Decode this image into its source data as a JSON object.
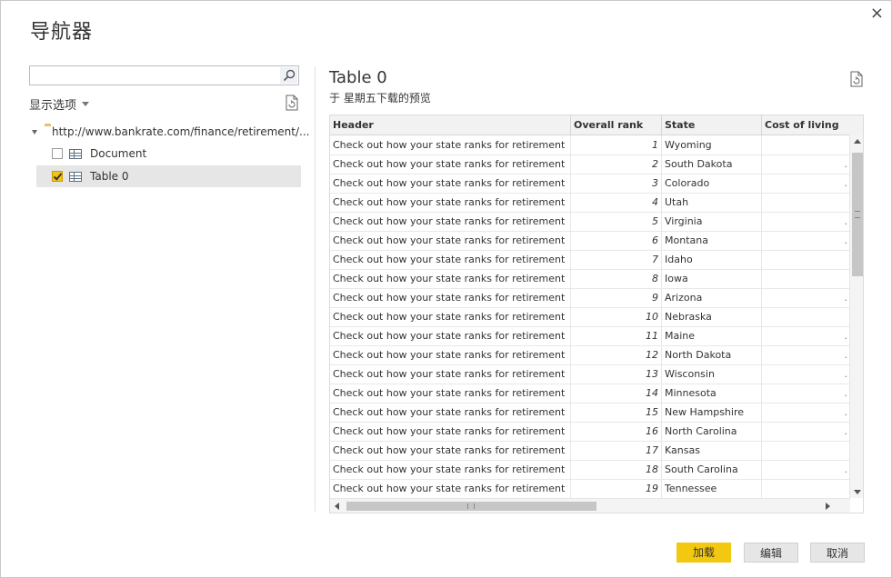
{
  "window": {
    "title": "导航器",
    "close_label": "×"
  },
  "left": {
    "search_value": "",
    "display_options_label": "显示选项",
    "tree_root": "http://www.bankrate.com/finance/retirement/...",
    "items": [
      {
        "label": "Document",
        "checked": false
      },
      {
        "label": "Table 0",
        "checked": true
      }
    ]
  },
  "preview": {
    "title": "Table 0",
    "subtitle": "于 星期五下载的预览",
    "columns": [
      "Header",
      "Overall rank",
      "State",
      "Cost of living"
    ],
    "rows": [
      {
        "header": "Check out how your state ranks for retirement",
        "rank": "1",
        "state": "Wyoming",
        "cost": ""
      },
      {
        "header": "Check out how your state ranks for retirement",
        "rank": "2",
        "state": "South Dakota",
        "cost": "."
      },
      {
        "header": "Check out how your state ranks for retirement",
        "rank": "3",
        "state": "Colorado",
        "cost": "."
      },
      {
        "header": "Check out how your state ranks for retirement",
        "rank": "4",
        "state": "Utah",
        "cost": ""
      },
      {
        "header": "Check out how your state ranks for retirement",
        "rank": "5",
        "state": "Virginia",
        "cost": "."
      },
      {
        "header": "Check out how your state ranks for retirement",
        "rank": "6",
        "state": "Montana",
        "cost": "."
      },
      {
        "header": "Check out how your state ranks for retirement",
        "rank": "7",
        "state": "Idaho",
        "cost": ""
      },
      {
        "header": "Check out how your state ranks for retirement",
        "rank": "8",
        "state": "Iowa",
        "cost": ""
      },
      {
        "header": "Check out how your state ranks for retirement",
        "rank": "9",
        "state": "Arizona",
        "cost": "."
      },
      {
        "header": "Check out how your state ranks for retirement",
        "rank": "10",
        "state": "Nebraska",
        "cost": ""
      },
      {
        "header": "Check out how your state ranks for retirement",
        "rank": "11",
        "state": "Maine",
        "cost": "."
      },
      {
        "header": "Check out how your state ranks for retirement",
        "rank": "12",
        "state": "North Dakota",
        "cost": "."
      },
      {
        "header": "Check out how your state ranks for retirement",
        "rank": "13",
        "state": "Wisconsin",
        "cost": "."
      },
      {
        "header": "Check out how your state ranks for retirement",
        "rank": "14",
        "state": "Minnesota",
        "cost": "."
      },
      {
        "header": "Check out how your state ranks for retirement",
        "rank": "15",
        "state": "New Hampshire",
        "cost": "."
      },
      {
        "header": "Check out how your state ranks for retirement",
        "rank": "16",
        "state": "North Carolina",
        "cost": "."
      },
      {
        "header": "Check out how your state ranks for retirement",
        "rank": "17",
        "state": "Kansas",
        "cost": ""
      },
      {
        "header": "Check out how your state ranks for retirement",
        "rank": "18",
        "state": "South Carolina",
        "cost": "."
      },
      {
        "header": "Check out how your state ranks for retirement",
        "rank": "19",
        "state": "Tennessee",
        "cost": ""
      }
    ]
  },
  "buttons": {
    "load": "加载",
    "edit": "编辑",
    "cancel": "取消"
  },
  "colors": {
    "accent": "#f2c811",
    "checkbox_checked": "#f0c419",
    "selected_bg": "#e6e6e6"
  },
  "icons": {
    "close": "close-icon",
    "search": "search-icon",
    "refresh": "refresh-icon",
    "folder": "folder-icon",
    "table": "table-icon"
  }
}
